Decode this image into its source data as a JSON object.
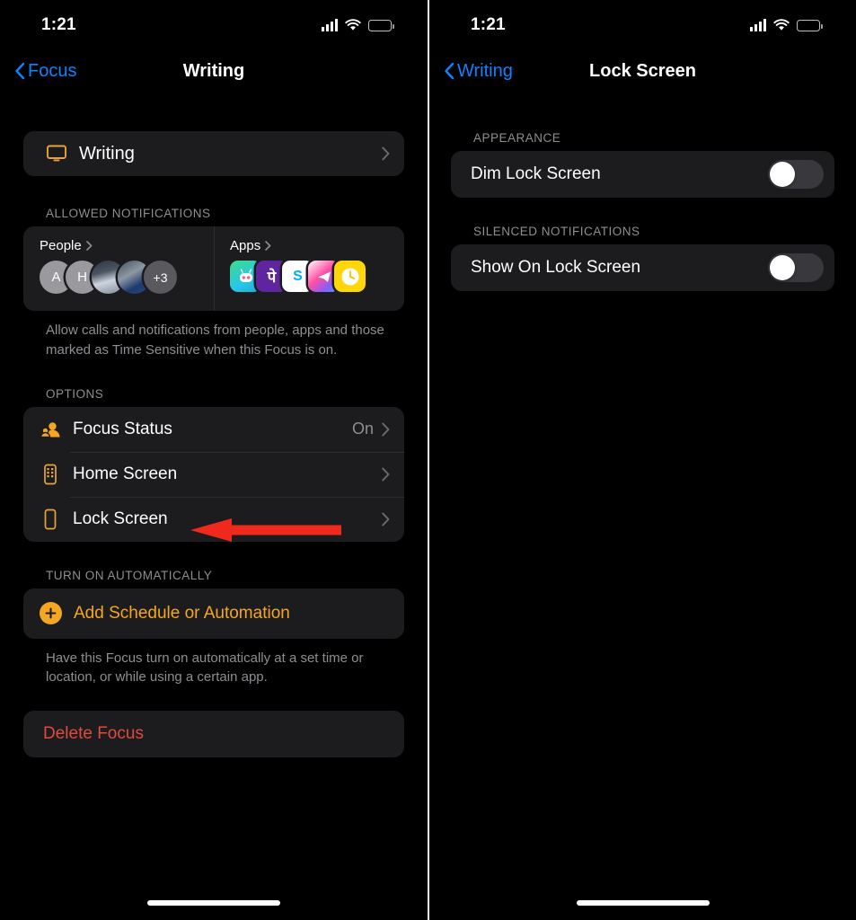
{
  "colors": {
    "accent_blue": "#0a84ff",
    "accent_orange": "#f5a623",
    "destructive_red": "#e04a3f",
    "annotation_red": "#ef2a1d",
    "card_bg": "#1c1c1e",
    "screen_bg": "#000000",
    "secondary_text": "#8e8e93"
  },
  "left_screen": {
    "status_bar": {
      "time": "1:21",
      "cellular_icon": "cellular-bars-icon",
      "wifi_icon": "wifi-icon",
      "battery_icon": "battery-low-icon",
      "battery_level_percent": 25
    },
    "nav": {
      "back_label": "Focus",
      "back_icon": "chevron-left-icon",
      "title": "Writing"
    },
    "focus_row": {
      "icon": "display-monitor-icon",
      "label": "Writing",
      "chevron": "chevron-right-icon"
    },
    "allowed_notifications": {
      "header": "ALLOWED NOTIFICATIONS",
      "people": {
        "title": "People",
        "disclosure_icon": "chevron-right-icon",
        "avatars": [
          {
            "type": "initial",
            "label": "A"
          },
          {
            "type": "initial",
            "label": "H"
          },
          {
            "type": "photo",
            "label": ""
          },
          {
            "type": "photo",
            "label": ""
          },
          {
            "type": "overflow",
            "label": "+3"
          }
        ]
      },
      "apps": {
        "title": "Apps",
        "disclosure_icon": "chevron-right-icon",
        "icons": [
          {
            "name": "robot-app-icon",
            "glyph": "🤖"
          },
          {
            "name": "phonepe-app-icon",
            "glyph": "पे"
          },
          {
            "name": "skype-app-icon",
            "glyph": "S"
          },
          {
            "name": "telegram-app-icon",
            "glyph": "➤"
          },
          {
            "name": "clock-app-icon",
            "glyph": "🕓"
          }
        ]
      },
      "footnote": "Allow calls and notifications from people, apps and those marked as Time Sensitive when this Focus is on."
    },
    "options": {
      "header": "OPTIONS",
      "rows": [
        {
          "icon": "focus-status-person-icon",
          "label": "Focus Status",
          "value": "On",
          "chevron": "chevron-right-icon"
        },
        {
          "icon": "home-screen-phone-icon",
          "label": "Home Screen",
          "value": "",
          "chevron": "chevron-right-icon"
        },
        {
          "icon": "lock-screen-phone-icon",
          "label": "Lock Screen",
          "value": "",
          "chevron": "chevron-right-icon"
        }
      ]
    },
    "turn_on_automatically": {
      "header": "TURN ON AUTOMATICALLY",
      "add_label": "Add Schedule or Automation",
      "add_icon": "plus-circle-icon",
      "footnote": "Have this Focus turn on automatically at a set time or location, or while using a certain app."
    },
    "delete": {
      "label": "Delete Focus"
    },
    "annotation": {
      "type": "arrow",
      "direction": "left",
      "points_to": "Lock Screen"
    },
    "home_indicator": "home-indicator"
  },
  "right_screen": {
    "status_bar": {
      "time": "1:21",
      "cellular_icon": "cellular-bars-icon",
      "wifi_icon": "wifi-icon",
      "battery_icon": "battery-low-icon",
      "battery_level_percent": 25
    },
    "nav": {
      "back_label": "Writing",
      "back_icon": "chevron-left-icon",
      "title": "Lock Screen"
    },
    "appearance": {
      "header": "APPEARANCE",
      "row": {
        "label": "Dim Lock Screen",
        "toggle_on": false
      }
    },
    "silenced_notifications": {
      "header": "SILENCED NOTIFICATIONS",
      "row": {
        "label": "Show On Lock Screen",
        "toggle_on": false
      }
    },
    "home_indicator": "home-indicator"
  }
}
